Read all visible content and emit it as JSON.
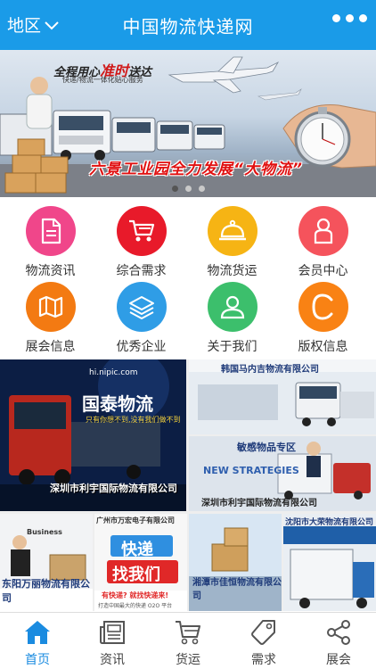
{
  "header": {
    "region_label": "地区",
    "title": "中国物流快递网",
    "region_icon": "chevron-down-icon",
    "more_icon": "more-dots-icon"
  },
  "banner": {
    "slogan_prefix": "全程用心",
    "slogan_emph": "准时",
    "slogan_suffix": "送达",
    "slogan_sub": "快递/物流一体化贴心服务",
    "caption": "六景工业园全力发展“大物流”",
    "slide_count": 3,
    "active_slide": 1
  },
  "grid": {
    "items": [
      {
        "label": "物流资讯",
        "icon": "document-icon",
        "color": "#f0468a"
      },
      {
        "label": "综合需求",
        "icon": "cart-icon",
        "color": "#e81a2a"
      },
      {
        "label": "物流货运",
        "icon": "cloche-icon",
        "color": "#f6b414"
      },
      {
        "label": "会员中心",
        "icon": "member-icon",
        "color": "#f5535c"
      },
      {
        "label": "展会信息",
        "icon": "map-icon",
        "color": "#f37a12"
      },
      {
        "label": "优秀企业",
        "icon": "layers-icon",
        "color": "#2f9de6"
      },
      {
        "label": "关于我们",
        "icon": "person-icon",
        "color": "#3cbf6c"
      },
      {
        "label": "版权信息",
        "icon": "copyright-icon",
        "color": "#f98214"
      }
    ]
  },
  "tiles": {
    "t1_brand": "国泰物流",
    "t1_site": "hi.nipic.com",
    "t1_sub": "只有你想不到,没有我们做不到",
    "t1_company": "深圳市利宇国际物流有限公司",
    "t2_company": "韩国马内吉物流有限公司",
    "t3_title": "敏感物品专区",
    "t3_sub": "NEW STRATEGIES",
    "t3_company": "深圳市利宇国际物流有限公司",
    "t4_label": "Business",
    "t4_company": "东阳万丽物流有限公司",
    "t5_top": "广州市万宏电子有限公司",
    "t5_big1": "快递",
    "t5_big2": "找我们",
    "t5_small": "有快递? 就找快递来!",
    "t5_small2": "打造中国最大的快递 O2O 平台",
    "t6_company": "湘潭市佳恒物流有限公司",
    "t7_company": "沈阳市大荣物流有限公司"
  },
  "tabbar": {
    "items": [
      {
        "label": "首页",
        "icon": "home-icon"
      },
      {
        "label": "资讯",
        "icon": "news-icon"
      },
      {
        "label": "货运",
        "icon": "cart-icon"
      },
      {
        "label": "需求",
        "icon": "tag-icon"
      },
      {
        "label": "展会",
        "icon": "share-icon"
      }
    ]
  }
}
